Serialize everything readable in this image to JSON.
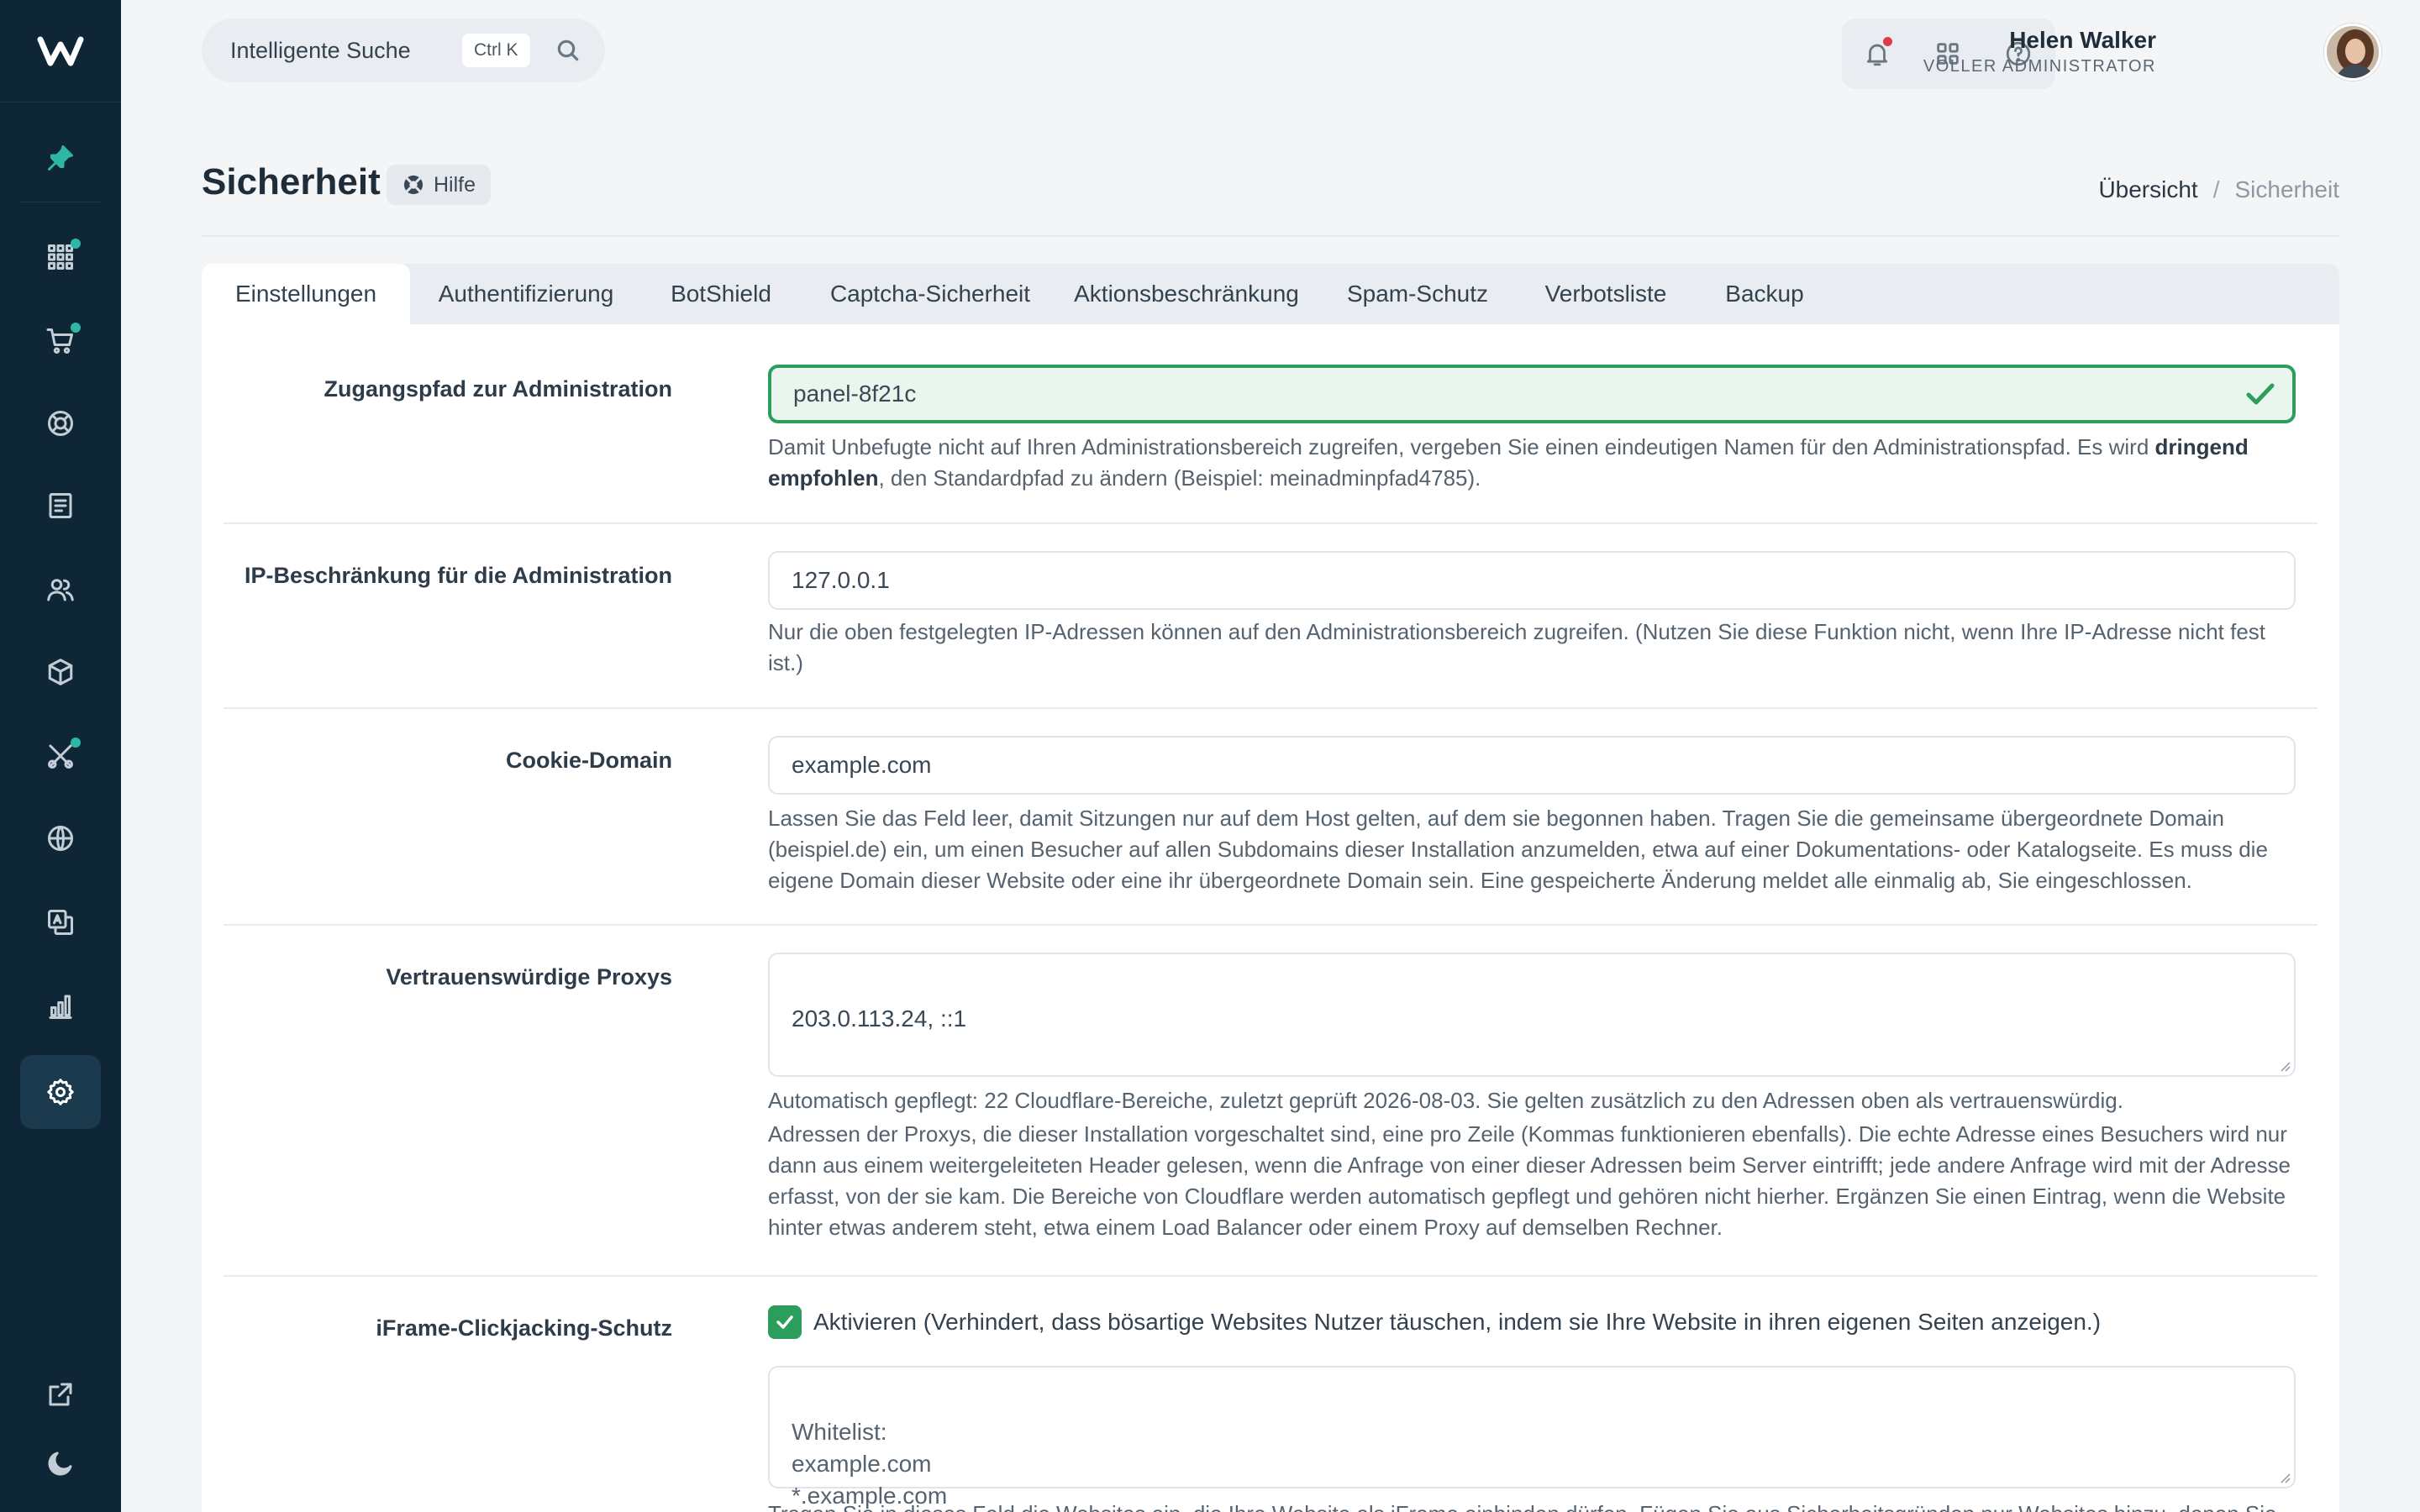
{
  "colors": {
    "sidebar_bg": "#0f2636",
    "accent": "#2fb6a6",
    "success": "#2b9e5b",
    "notification": "#e0384b"
  },
  "sidebar": {
    "items": [
      {
        "name": "pin-icon"
      },
      {
        "name": "apps-icon",
        "badge": true
      },
      {
        "name": "cart-icon",
        "badge": true
      },
      {
        "name": "lifebuoy-icon"
      },
      {
        "name": "document-icon"
      },
      {
        "name": "users-icon"
      },
      {
        "name": "box-icon"
      },
      {
        "name": "tools-icon",
        "badge": true
      },
      {
        "name": "globe-icon"
      },
      {
        "name": "translate-icon"
      },
      {
        "name": "chart-icon"
      },
      {
        "name": "settings-icon",
        "active": true
      },
      {
        "name": "external-link-icon"
      },
      {
        "name": "moon-icon"
      }
    ]
  },
  "topbar": {
    "search_label": "Intelligente Suche",
    "search_shortcut": "Ctrl K",
    "user_name": "Helen Walker",
    "user_role": "VOLLER ADMINISTRATOR"
  },
  "page": {
    "title": "Sicherheit",
    "help_label": "Hilfe",
    "breadcrumb": {
      "home": "Übersicht",
      "separator": "/",
      "current": "Sicherheit"
    }
  },
  "tabs": [
    {
      "label": "Einstellungen",
      "active": true
    },
    {
      "label": "Authentifizierung"
    },
    {
      "label": "BotShield"
    },
    {
      "label": "Captcha-Sicherheit"
    },
    {
      "label": "Aktionsbeschränkung"
    },
    {
      "label": "Spam-Schutz"
    },
    {
      "label": "Verbotsliste"
    },
    {
      "label": "Backup"
    }
  ],
  "settings": {
    "admin_path": {
      "label": "Zugangspfad zur Administration",
      "value": "panel-8f21c",
      "help_before": "Damit Unbefugte nicht auf Ihren Administrationsbereich zugreifen, vergeben Sie einen eindeutigen Namen für den Administrationspfad. Es wird ",
      "help_bold": "dringend empfohlen",
      "help_after": ", den Standardpfad zu ändern (Beispiel: meinadminpfad4785)."
    },
    "ip_restriction": {
      "label": "IP-Beschränkung für die Administration",
      "value": "127.0.0.1",
      "help": "Nur die oben festgelegten IP-Adressen können auf den Administrationsbereich zugreifen. (Nutzen Sie diese Funktion nicht, wenn Ihre IP-Adresse nicht fest ist.)"
    },
    "cookie_domain": {
      "label": "Cookie-Domain",
      "value": "example.com",
      "help": "Lassen Sie das Feld leer, damit Sitzungen nur auf dem Host gelten, auf dem sie begonnen haben. Tragen Sie die gemeinsame übergeordnete Domain (beispiel.de) ein, um einen Besucher auf allen Subdomains dieser Installation anzumelden, etwa auf einer Dokumentations- oder Katalogseite. Es muss die eigene Domain dieser Website oder eine ihr übergeordnete Domain sein. Eine gespeicherte Änderung meldet alle einmalig ab, Sie eingeschlossen."
    },
    "trusted_proxies": {
      "label": "Vertrauenswürdige Proxys",
      "value": "203.0.113.24, ::1",
      "note": "Automatisch gepflegt: 22 Cloudflare-Bereiche, zuletzt geprüft 2026-08-03. Sie gelten zusätzlich zu den Adressen oben als vertrauenswürdig.",
      "help": "Adressen der Proxys, die dieser Installation vorgeschaltet sind, eine pro Zeile (Kommas funktionieren ebenfalls). Die echte Adresse eines Besuchers wird nur dann aus einem weitergeleiteten Header gelesen, wenn die Anfrage von einer dieser Adressen beim Server eintrifft; jede andere Anfrage wird mit der Adresse erfasst, von der sie kam. Die Bereiche von Cloudflare werden automatisch gepflegt und gehören nicht hierher. Ergänzen Sie einen Eintrag, wenn die Website hinter etwas anderem steht, etwa einem Load Balancer oder einem Proxy auf demselben Rechner."
    },
    "iframe_protection": {
      "label": "iFrame-Clickjacking-Schutz",
      "checked": true,
      "checkbox_label": "Aktivieren (Verhindert, dass bösartige Websites Nutzer täuschen, indem sie Ihre Website in ihren eigenen Seiten anzeigen.)",
      "whitelist": "Whitelist:\nexample.com\n*.example.com",
      "help": "Tragen Sie in dieses Feld die Websites ein, die Ihre Website als iFrame einbinden dürfen. Fügen Sie aus Sicherheitsgründen nur Websites hinzu, denen Sie"
    }
  }
}
